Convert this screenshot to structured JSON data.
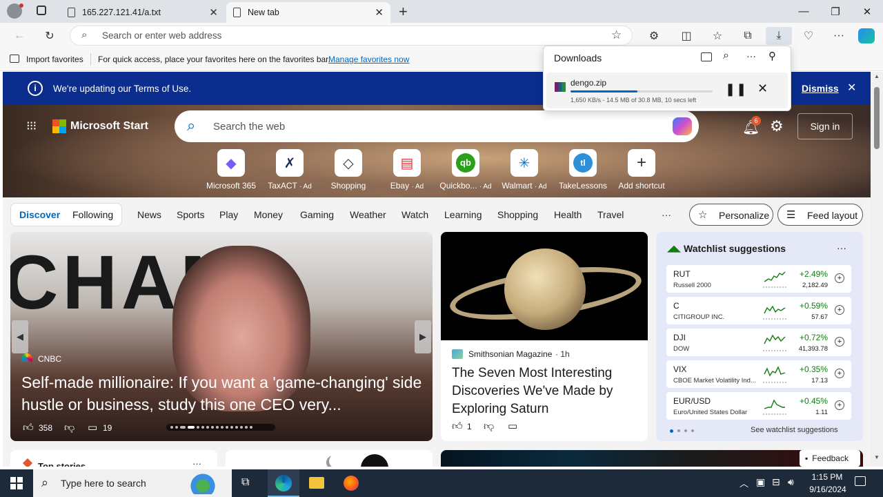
{
  "tabs": [
    {
      "title": "165.227.121.41/a.txt"
    },
    {
      "title": "New tab"
    }
  ],
  "address": {
    "placeholder": "Search or enter web address"
  },
  "favbar": {
    "import": "Import favorites",
    "message": "For quick access, place your favorites here on the favorites bar.",
    "manage": "Manage favorites now"
  },
  "downloads": {
    "title": "Downloads",
    "file": "dengo.zip",
    "status": "1,650 KB/s - 14.5 MB of 30.8 MB, 10 secs left",
    "progress": 0.47
  },
  "terms": {
    "text": "We're updating our Terms of Use.",
    "dismiss": "Dismiss"
  },
  "msstart": {
    "brand": "Microsoft Start",
    "search_placeholder": "Search the web",
    "notif_count": "6",
    "signin": "Sign in"
  },
  "shortcuts": [
    {
      "label": "Microsoft 365",
      "ad": ""
    },
    {
      "label": "TaxACT",
      "ad": "· Ad"
    },
    {
      "label": "Shopping",
      "ad": ""
    },
    {
      "label": "Ebay",
      "ad": "· Ad"
    },
    {
      "label": "Quickbo...",
      "ad": "· Ad"
    },
    {
      "label": "Walmart",
      "ad": "· Ad"
    },
    {
      "label": "TakeLessons",
      "ad": ""
    },
    {
      "label": "Add shortcut",
      "ad": ""
    }
  ],
  "nav": {
    "discover": "Discover",
    "following": "Following",
    "items": [
      "News",
      "Sports",
      "Play",
      "Money",
      "Gaming",
      "Weather",
      "Watch",
      "Learning",
      "Shopping",
      "Health",
      "Travel"
    ],
    "more": "···",
    "personalize": "Personalize",
    "feed_layout": "Feed layout"
  },
  "hero_story": {
    "source": "CNBC",
    "headline": "Self-made millionaire: If you want a 'game-changing' side hustle or business, study this one CEO very...",
    "likes": "358",
    "comments": "19",
    "bg_text": "CHAM"
  },
  "saturn_story": {
    "source": "Smithsonian Magazine",
    "time": "· 1h",
    "headline": "The Seven Most Interesting Discoveries We've Made by Exploring Saturn",
    "likes": "1"
  },
  "watchlist": {
    "title": "Watchlist suggestions",
    "more": "···",
    "see_more": "See watchlist suggestions",
    "rows": [
      {
        "symbol": "RUT",
        "name": "Russell 2000",
        "change": "+2.49%",
        "price": "2,182.49"
      },
      {
        "symbol": "C",
        "name": "CITIGROUP INC.",
        "change": "+0.59%",
        "price": "57.67"
      },
      {
        "symbol": "DJI",
        "name": "DOW",
        "change": "+0.72%",
        "price": "41,393.78"
      },
      {
        "symbol": "VIX",
        "name": "CBOE Market Volatility Ind...",
        "change": "+0.35%",
        "price": "17.13"
      },
      {
        "symbol": "EUR/USD",
        "name": "Euro/United States Dollar",
        "change": "+0.45%",
        "price": "1.11"
      }
    ]
  },
  "lower": {
    "top_stories": "Top stories",
    "feedback": "Feedback"
  },
  "taskbar": {
    "search": "Type here to search",
    "time": "1:15 PM",
    "date": "9/16/2024"
  },
  "colors": {
    "accent": "#0067c0",
    "terms_bg": "#0a2d8e",
    "positive": "#107c10"
  }
}
